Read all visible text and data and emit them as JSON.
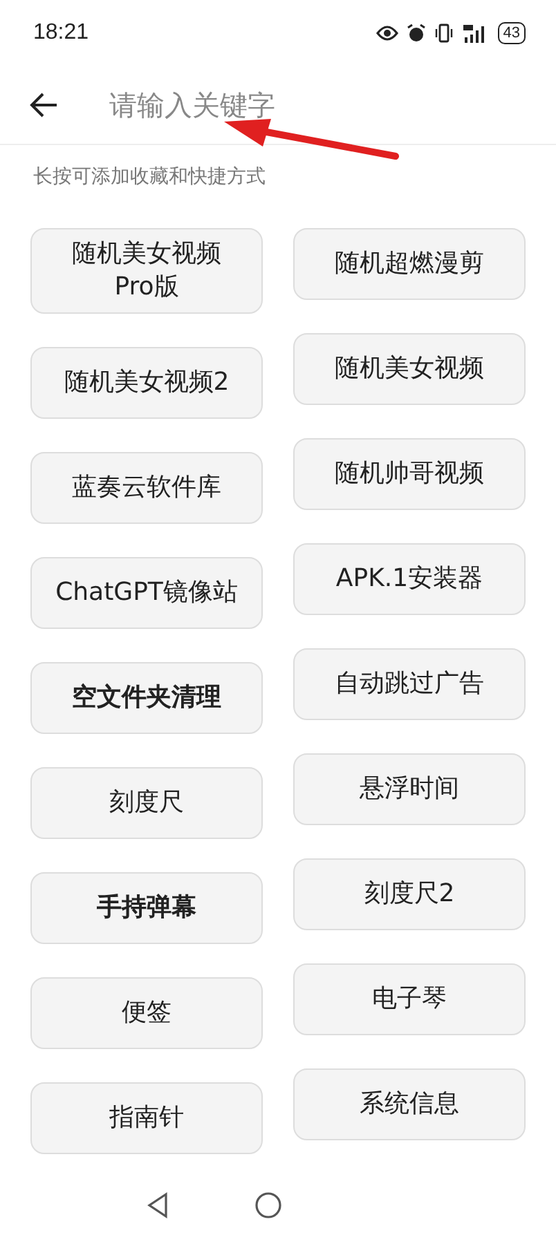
{
  "status_bar": {
    "time": "18:21",
    "battery": "43"
  },
  "search": {
    "placeholder": "请输入关键字"
  },
  "hint": "长按可添加收藏和快捷方式",
  "columns": [
    [
      {
        "label": "随机美女视频\nPro版",
        "bold": false
      },
      {
        "label": "随机美女视频2",
        "bold": false
      },
      {
        "label": "蓝奏云软件库",
        "bold": false
      },
      {
        "label": "ChatGPT镜像站",
        "bold": false
      },
      {
        "label": "空文件夹清理",
        "bold": true
      },
      {
        "label": "刻度尺",
        "bold": false
      },
      {
        "label": "手持弹幕",
        "bold": true
      },
      {
        "label": "便签",
        "bold": false
      },
      {
        "label": "指南针",
        "bold": false
      }
    ],
    [
      {
        "label": "随机超燃漫剪",
        "bold": false
      },
      {
        "label": "随机美女视频",
        "bold": false
      },
      {
        "label": "随机帅哥视频",
        "bold": false
      },
      {
        "label": "APK.1安装器",
        "bold": false
      },
      {
        "label": "自动跳过广告",
        "bold": false
      },
      {
        "label": "悬浮时间",
        "bold": false
      },
      {
        "label": "刻度尺2",
        "bold": false
      },
      {
        "label": "电子琴",
        "bold": false
      },
      {
        "label": "系统信息",
        "bold": false
      }
    ]
  ]
}
